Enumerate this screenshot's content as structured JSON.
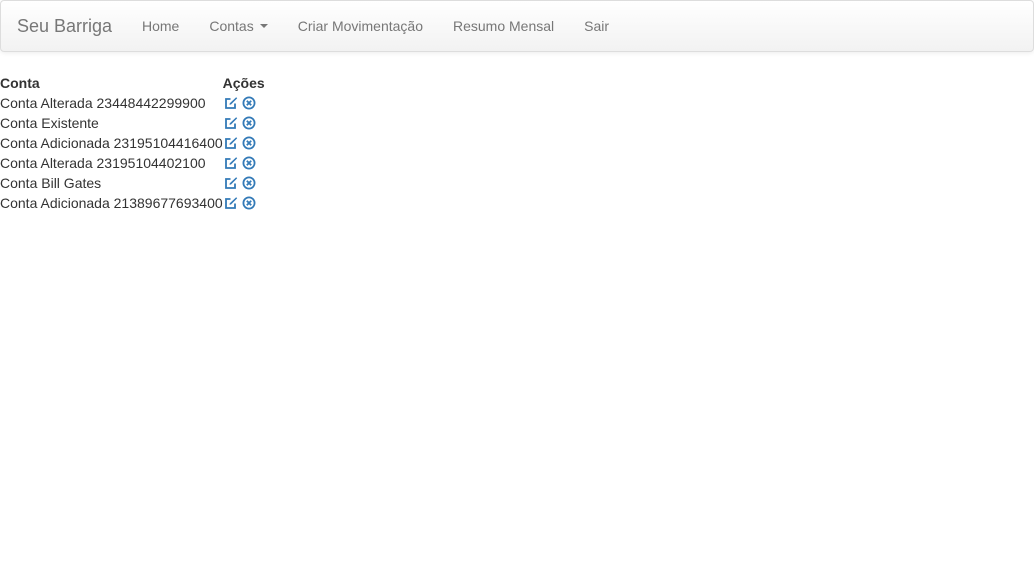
{
  "navbar": {
    "brand": "Seu Barriga",
    "items": [
      {
        "label": "Home"
      },
      {
        "label": "Contas"
      },
      {
        "label": "Criar Movimentação"
      },
      {
        "label": "Resumo Mensal"
      },
      {
        "label": "Sair"
      }
    ]
  },
  "table": {
    "headers": [
      "Conta",
      "Ações"
    ],
    "rows": [
      {
        "name": "Conta Alterada 23448442299900"
      },
      {
        "name": "Conta Existente"
      },
      {
        "name": "Conta Adicionada 23195104416400"
      },
      {
        "name": "Conta Alterada 23195104402100"
      },
      {
        "name": "Conta Bill Gates"
      },
      {
        "name": "Conta Adicionada 21389677693400"
      }
    ],
    "action_icons": [
      "edit-icon",
      "remove-circle-icon"
    ]
  },
  "colors": {
    "link": "#337ab7",
    "nav_text": "#777777",
    "text": "#333333"
  }
}
